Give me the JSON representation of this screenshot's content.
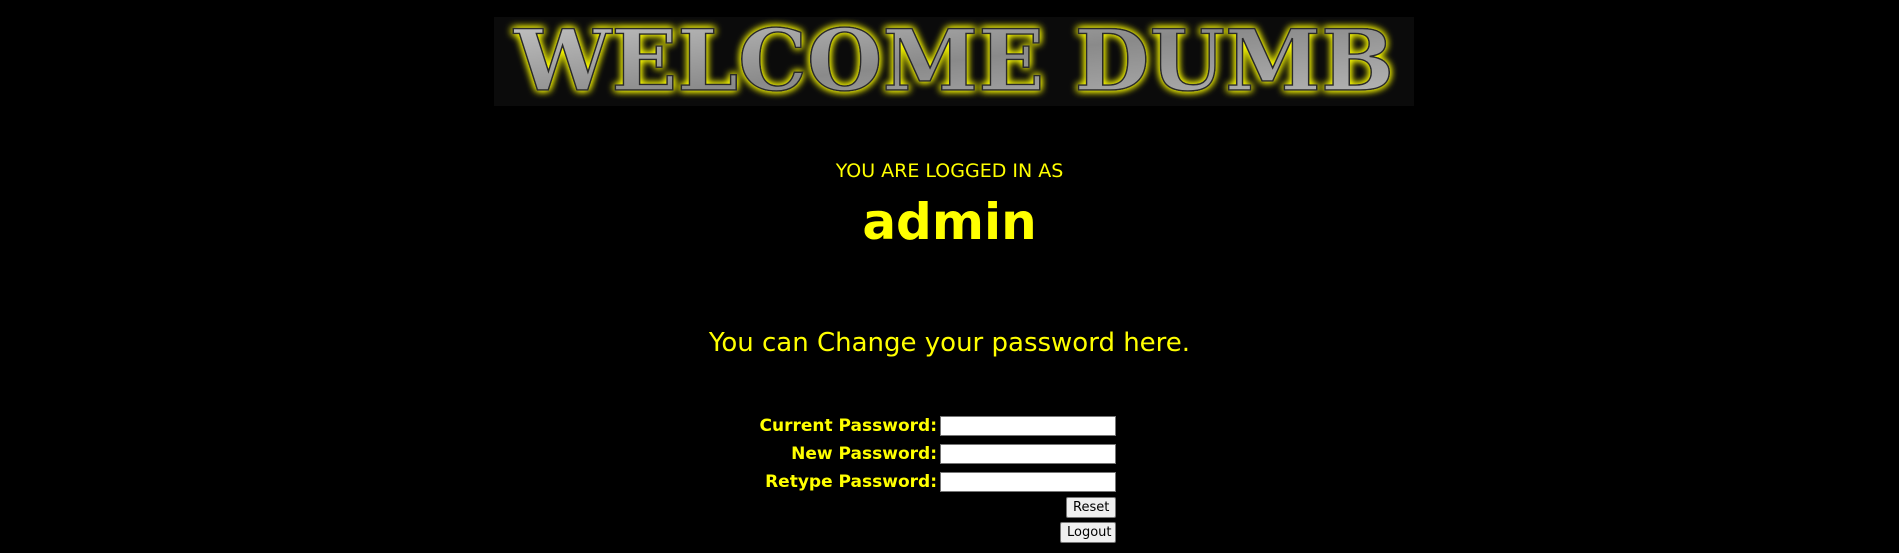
{
  "banner": {
    "title": "WELCOME DUMB",
    "glow_color": "#ffff00",
    "fill_color": "#9a9a9a"
  },
  "session": {
    "logged_in_label": "YOU ARE LOGGED IN AS",
    "username": "admin"
  },
  "message": "You can Change your password here.",
  "form": {
    "current_password_label": "Current Password:",
    "current_password_value": "",
    "new_password_label": "New Password:",
    "new_password_value": "",
    "retype_password_label": "Retype Password:",
    "retype_password_value": "",
    "reset_label": "Reset",
    "logout_label": "Logout"
  },
  "colors": {
    "background": "#000000",
    "text": "#ffff00"
  }
}
